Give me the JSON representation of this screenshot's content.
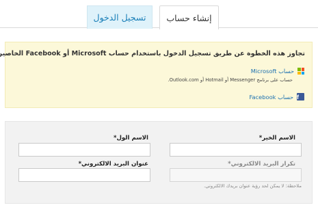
{
  "tabs": {
    "create_account": "إنشاء حساب",
    "login": "تسجيل الدخول"
  },
  "info": {
    "title": "تجاوز هذه الخطوة عن طريق تسجيل الدخول باستخدام حساب Microsoft أو Facebook الخاصين بك",
    "microsoft_label": "حساب Microsoft",
    "microsoft_note": "حساب على برنامج Messenger أو Hotmail أو Outlook.com.",
    "facebook_label": "حساب Facebook"
  },
  "form": {
    "last_name_label": "الاسم الخير*",
    "first_name_label": "الاسم الول*",
    "confirm_email_label": "تكرار البريد الالكتروني*",
    "email_label": "عنوان البريد الالكتروني*",
    "note": "ملاحظة: لا يمكن لحد رؤية عنوان بريدك الالكتروني."
  },
  "colors": {
    "tab_active_bg": "#ffffff",
    "tab_login_bg": "#dff2fa",
    "info_bg": "#fcf8d9",
    "form_bg": "#f2f2f2",
    "link": "#1a6fb0",
    "facebook_blue": "#3b5998",
    "ms_red": "#f25022",
    "ms_green": "#7fba00",
    "ms_blue": "#00a4ef",
    "ms_yellow": "#ffb900"
  },
  "icons": {
    "microsoft": "microsoft-logo-icon",
    "facebook": "facebook-logo-icon"
  }
}
